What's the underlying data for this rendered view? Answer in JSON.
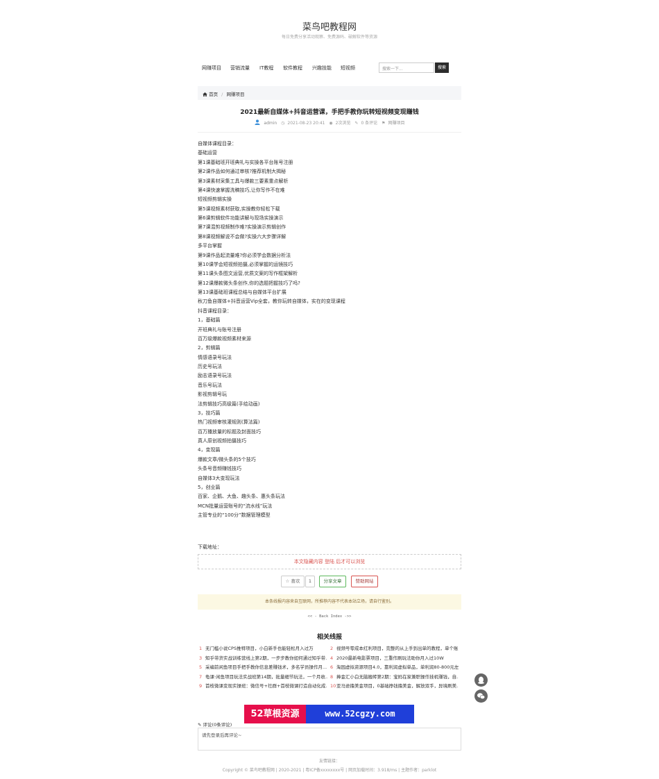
{
  "site": {
    "title": "菜鸟吧教程网",
    "subtitle": "每日免费分享活动观察、免费源码、破解软件等资源"
  },
  "nav": {
    "items": [
      "网赚项目",
      "营销流量",
      "IT教程",
      "软件教程",
      "兴趣技能",
      "短视频"
    ],
    "search_placeholder": "搜索一下...",
    "search_button": "搜索"
  },
  "breadcrumb": {
    "home": "首页",
    "sep": "/",
    "category": "网赚项目"
  },
  "post": {
    "title": "2021最新自媒体+抖音运营课，手把手教你玩转短视频变现赚钱",
    "author": "admin",
    "date": "2021-08-23 20:41",
    "views": "2次浏览",
    "comments": "0 条评论",
    "category": "网赚项目",
    "content_lines": [
      "自媒体课程目录：",
      "基础运营",
      "第1课基础班开班典礼与实操各平台账号注册",
      "第2课作品如何通过审核?推荐机制大揭秘",
      "第3课素材采集工具与爆款三要素重点解析",
      "第4课快速掌握洗稿技巧,让你写作不在难",
      "短视频剪辑实操",
      "第5课视频素材获取,实操教你轻松下载",
      "第6课剪辑软件功能讲解与现场实操演示",
      "第7课混剪视频制作难?实操演示剪辑创作",
      "第8课视频解说不会做?实操六大步骤详解",
      "多平台掌握",
      "第9课作品起流量难?你必须学会数据分析法",
      "第10课学会短视频拍摄,必须掌握的运镜技巧",
      "第11课头条图文运营,优质文案的写作框架解析",
      "第12课爆款微头条创作,你的选题把握技巧了吗?",
      "第13课基础班课程总结与自媒体平台扩展",
      "秋刀鱼自媒体+抖音运营Vip全套，教你玩转自媒体，实在的变现课程",
      "抖音课程目录：",
      "1，基础篇",
      "开班典礼与账号注册",
      "百万级爆款视频素材来源",
      "2，剪辑篇",
      "情感语录号玩法",
      "历史号玩法",
      "励志语录号玩法",
      "音乐号玩法",
      "影视剪辑号玩",
      "法剪辑技巧高级篇(手绘动画)",
      "3，技巧篇",
      "热门视频审核灌规则(算法篇)",
      "百万播放量的标题及封面技巧",
      "真人原创视频拍摄技巧",
      "4，变现篇",
      "爆款文章/微头条的5个技巧",
      "头条号音频赚钱技巧",
      "自媒体3大变现玩法",
      "5，创业篇",
      "百家、企鹅、大鱼、趣头条、惠头条玩法",
      "MCN批量运营账号的“流水线”玩法",
      "主管专业的“100分”数据管理模型"
    ]
  },
  "download": {
    "label": "下载地址：",
    "hidden_text": "本文隐藏内容 登陆 后才可以浏览"
  },
  "actions": {
    "like_label": "☆ 喜欢",
    "like_count": "1",
    "share_label": "分享文章",
    "donate_label": "赞助网站"
  },
  "notice": "本条线报内容来自互联网，所推荐内容不代表本站立场，请自行鉴别。",
  "back_index": "<< - Back Index ->>",
  "related": {
    "title": "相关线报",
    "left": [
      {
        "num": "1",
        "text": "无门槛小说CPS推特项目，小白新手也能轻松月入过万"
      },
      {
        "num": "3",
        "text": "知乎带货实战训练营线上第2期，一步步教你如何通过知乎带..."
      },
      {
        "num": "5",
        "text": "采编前闲鱼项目手把手教你信息差赚钱术，多名学员操作月..."
      },
      {
        "num": "7",
        "text": "龟课·闲鱼项目玩法实战班第14期，批量细节玩法，一个月收..."
      },
      {
        "num": "9",
        "text": "首枝微课变现实操班：微信号+社群+首枝微课打造自动化成..."
      }
    ],
    "right": [
      {
        "num": "2",
        "text": "视频号零成本红利项目，完整的从上手到出单的教程，单个账..."
      },
      {
        "num": "4",
        "text": "2020最新电影票项目，三重作刷玩法助你月入过10W"
      },
      {
        "num": "6",
        "text": "淘园虚拟资源项目4.0，靠利润虚拟单品，单利润80-800元左右"
      },
      {
        "num": "8",
        "text": "捧金汇小白无脑搬砖第2期：宝妈在家兼职操作挂机赚钱，自..."
      },
      {
        "num": "10",
        "text": "亚马逊撸美金项目，0基础挣钱撸美金，解放双手，异境刷美..."
      }
    ]
  },
  "watermark": {
    "left": "52草根资源",
    "right": "www.52cgzy.com"
  },
  "comments": {
    "label": "评论(0条评论)",
    "placeholder": "请先登录后再评论~"
  },
  "footer": {
    "friend_links": "友情链接：",
    "copyright": "Copyright © 菜鸟吧教程网 | 2020-2021 | 粤ICP备xxxxxxxx号 | 网页加载时间：3.918/ms | 主题作者：parklot"
  },
  "colors": {
    "accent_red": "#d9534f",
    "watermark_red": "#e60f4b",
    "watermark_blue": "#1f3fd9",
    "notice_bg": "#fcf8e3",
    "search_btn_bg": "#2c2c2c"
  }
}
